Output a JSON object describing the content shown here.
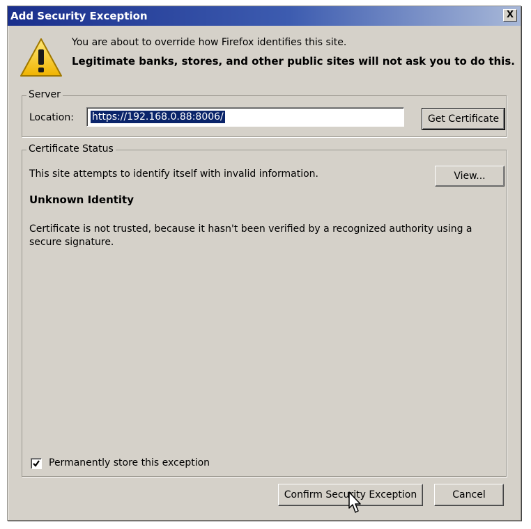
{
  "dialog": {
    "title": "Add Security Exception",
    "close_label": "X",
    "message_line1": "You are about to override how Firefox identifies this site.",
    "message_line2": "Legitimate banks, stores, and other public sites will not ask you to do this.",
    "icon": "warning-icon"
  },
  "server": {
    "legend": "Server",
    "location_label": "Location:",
    "location_value": "https://192.168.0.88:8006/",
    "get_certificate_label": "Get Certificate"
  },
  "certificate_status": {
    "legend": "Certificate Status",
    "status_line": "This site attempts to identify itself with invalid information.",
    "view_label": "View...",
    "identity_heading": "Unknown Identity",
    "description": "Certificate is not trusted, because it hasn't been verified by a recognized authority using a secure signature.",
    "permanent_label": "Permanently store this exception",
    "permanent_checked": true
  },
  "buttons": {
    "confirm_label": "Confirm Security Exception",
    "cancel_label": "Cancel"
  },
  "colors": {
    "titlebar": "#1a2f8c",
    "face": "#d5d1c9",
    "selection": "#0a246a"
  }
}
